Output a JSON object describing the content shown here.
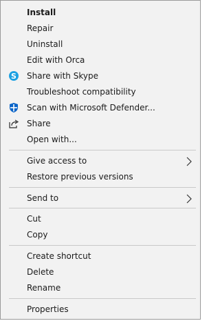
{
  "menu": {
    "items": {
      "install": "Install",
      "repair": "Repair",
      "uninstall": "Uninstall",
      "edit_with_orca": "Edit with Orca",
      "share_with_skype": "Share with Skype",
      "troubleshoot": "Troubleshoot compatibility",
      "scan_defender": "Scan with Microsoft Defender...",
      "share": "Share",
      "open_with": "Open with...",
      "give_access_to": "Give access to",
      "restore_previous_versions": "Restore previous versions",
      "send_to": "Send to",
      "cut": "Cut",
      "copy": "Copy",
      "create_shortcut": "Create shortcut",
      "delete": "Delete",
      "rename": "Rename",
      "properties": "Properties"
    },
    "icons": {
      "skype": "skype-icon",
      "defender": "defender-shield-icon",
      "share": "share-icon",
      "submenu": "chevron-right-icon"
    },
    "colors": {
      "background": "#f2f2f2",
      "border": "#9a9a9a",
      "separator": "#c9c9c9",
      "text": "#1a1a1a",
      "skype": "#1da1e2",
      "defender": "#0a64c8"
    }
  }
}
